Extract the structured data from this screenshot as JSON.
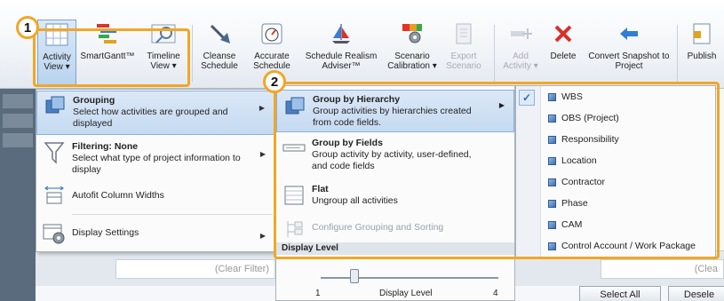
{
  "ribbon": {
    "activity_view": "Activity View ▾",
    "smartgantt": "SmartGantt™",
    "timeline_view": "Timeline View ▾",
    "cleanse_schedule": "Cleanse Schedule",
    "accurate_schedule": "Accurate Schedule",
    "schedule_realism": "Schedule Realism Adviser™",
    "scenario_calibration": "Scenario Calibration ▾",
    "export_scenario": "Export Scenario",
    "add_activity": "Add Activity ▾",
    "delete": "Delete",
    "convert_snapshot": "Convert Snapshot to Project",
    "publish": "Publish"
  },
  "menu1": {
    "grouping_title": "Grouping",
    "grouping_desc": "Select how activities are grouped and displayed",
    "filtering_title": "Filtering: None",
    "filtering_desc": "Select what type of project information to display",
    "autofit": "Autofit Column Widths",
    "display_settings": "Display Settings"
  },
  "menu2": {
    "hierarchy_title": "Group by Hierarchy",
    "hierarchy_desc": "Group activities by hierarchies created from code fields.",
    "fields_title": "Group by Fields",
    "fields_desc": "Group activity by activity, user-defined, and code fields",
    "flat_title": "Flat",
    "flat_desc": "Ungroup all activities",
    "configure": "Configure Grouping and Sorting",
    "display_level_header": "Display Level",
    "slider_min": "1",
    "slider_label": "Display Level",
    "slider_max": "4",
    "slider_value": 1
  },
  "menu3": {
    "items": [
      "WBS",
      "OBS (Project)",
      "Responsibility",
      "Location",
      "Contractor",
      "Phase",
      "CAM",
      "Control Account / Work Package"
    ]
  },
  "background": {
    "clear_filter_1": "(Clear Filter)",
    "clear_filter_2": "(Clea",
    "select_all": "Select All",
    "deselect": "Desele"
  },
  "callouts": {
    "one": "1",
    "two": "2"
  },
  "colors": {
    "callout": "#f0a726",
    "highlight": "#c5daf1"
  }
}
